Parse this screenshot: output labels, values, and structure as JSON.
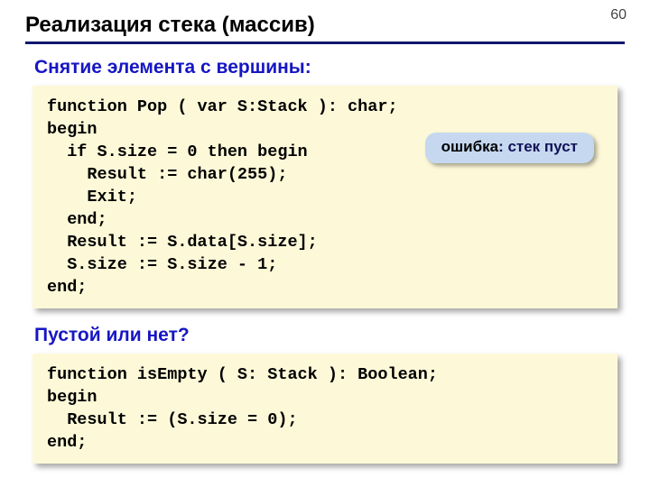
{
  "page_number": "60",
  "title": "Реализация стека (массив)",
  "section1": {
    "heading": "Снятие элемента с вершины:",
    "code": "function Pop ( var S:Stack ): char;\nbegin\n  if S.size = 0 then begin\n    Result := char(255);\n    Exit;\n  end;\n  Result := S.data[S.size];\n  S.size := S.size - 1;\nend;",
    "callout_label": "ошибка",
    "callout_text": ":\nстек пуст"
  },
  "section2": {
    "heading": "Пустой или нет?",
    "code": "function isEmpty ( S: Stack ): Boolean;\nbegin\n  Result := (S.size = 0);\nend;"
  }
}
